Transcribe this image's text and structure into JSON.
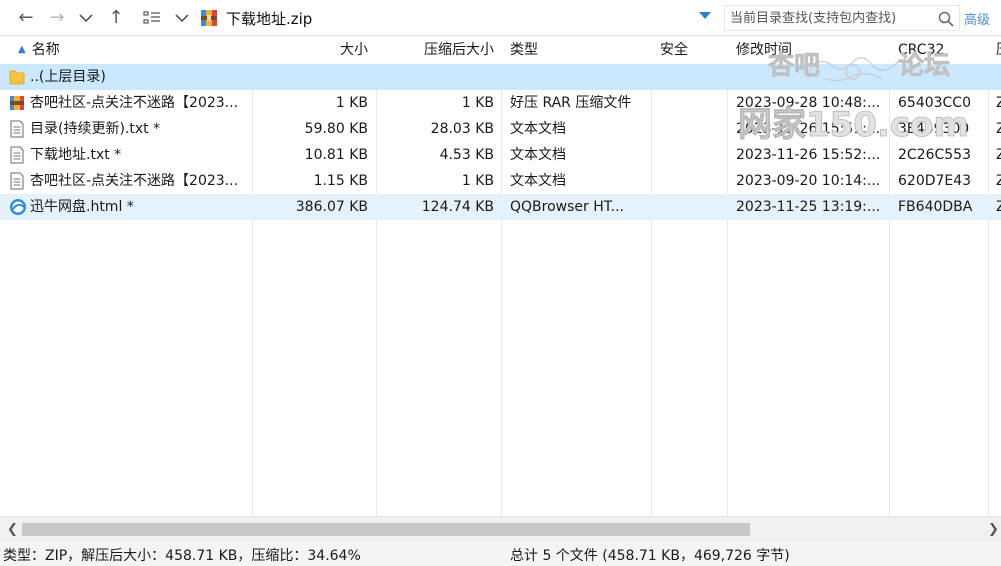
{
  "toolbar": {
    "path": "下载地址.zip",
    "search_placeholder": "当前目录查找(支持包内查找)",
    "advanced_label": "高级"
  },
  "columns": {
    "name": "名称",
    "size": "大小",
    "compressed": "压缩后大小",
    "type": "类型",
    "security": "安全",
    "modified": "修改时间",
    "crc": "CRC32",
    "extra": "压"
  },
  "parent_row": {
    "name": "..(上层目录)"
  },
  "rows": [
    {
      "icon": "rar-archive-icon",
      "name": "杏吧社区-点关注不迷路【2023...",
      "size": "1 KB",
      "compressed": "1 KB",
      "type": "好压 RAR 压缩文件",
      "security": "",
      "modified": "2023-09-28 10:48:...",
      "crc": "65403CC0",
      "extra": "Z"
    },
    {
      "icon": "text-file-icon",
      "name": "目录(持续更新).txt *",
      "size": "59.80 KB",
      "compressed": "28.03 KB",
      "type": "文本文档",
      "security": "",
      "modified": "2023-11-26 15:51:...",
      "crc": "3E449300",
      "extra": "Z"
    },
    {
      "icon": "text-file-icon",
      "name": "下载地址.txt *",
      "size": "10.81 KB",
      "compressed": "4.53 KB",
      "type": "文本文档",
      "security": "",
      "modified": "2023-11-26 15:52:...",
      "crc": "2C26C553",
      "extra": "Z"
    },
    {
      "icon": "text-file-icon",
      "name": "杏吧社区-点关注不迷路【2023...",
      "size": "1.15 KB",
      "compressed": "1 KB",
      "type": "文本文档",
      "security": "",
      "modified": "2023-09-20 10:14:...",
      "crc": "620D7E43",
      "extra": "Z"
    },
    {
      "icon": "browser-html-icon",
      "name": "迅牛网盘.html *",
      "size": "386.07 KB",
      "compressed": "124.74 KB",
      "type": "QQBrowser HT...",
      "security": "",
      "modified": "2023-11-25 13:19:...",
      "crc": "FB640DBA",
      "extra": "Z"
    }
  ],
  "status": {
    "left": "类型：ZIP，解压后大小：458.71 KB，压缩比：34.64%",
    "right": "总计 5 个文件 (458.71 KB，469,726 字节)"
  },
  "watermark": {
    "top": "杏吧",
    "top_right": "论坛",
    "bottom": "网家150.com"
  },
  "colors": {
    "accent": "#2e7fd6",
    "parent_row_bg": "#cce8ff",
    "selected_row_bg": "#e5f1fb",
    "link": "#4d8fd6"
  }
}
